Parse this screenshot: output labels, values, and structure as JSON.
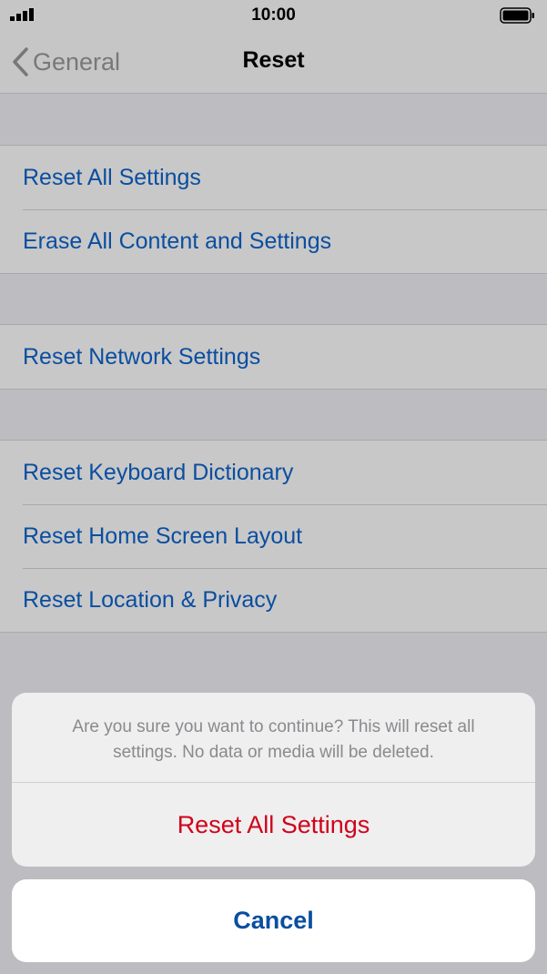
{
  "status_bar": {
    "time": "10:00",
    "signal_icon": "signal-bars-icon",
    "battery_icon": "battery-full-icon"
  },
  "nav": {
    "back_label": "General",
    "back_icon": "chevron-left-icon",
    "title": "Reset"
  },
  "groups": [
    {
      "items": [
        "Reset All Settings",
        "Erase All Content and Settings"
      ]
    },
    {
      "items": [
        "Reset Network Settings"
      ]
    },
    {
      "items": [
        "Reset Keyboard Dictionary",
        "Reset Home Screen Layout",
        "Reset Location & Privacy"
      ]
    }
  ],
  "action_sheet": {
    "message": "Are you sure you want to continue? This will reset all settings. No data or media will be deleted.",
    "destructive_action": "Reset All Settings",
    "cancel_label": "Cancel"
  },
  "colors": {
    "link_blue": "#0a4ea0",
    "destructive_red": "#d0021b",
    "dim_background": "#bcbcc1"
  }
}
